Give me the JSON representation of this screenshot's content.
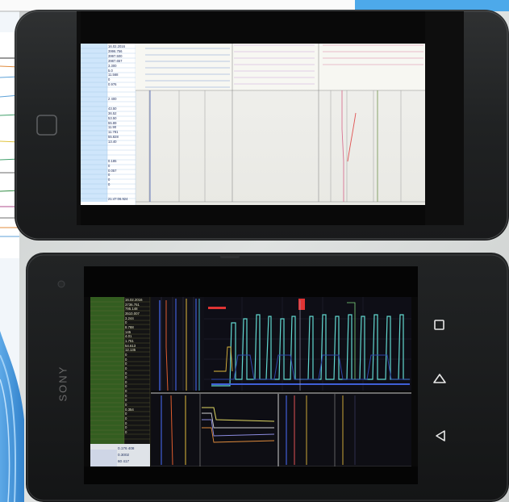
{
  "scene": {
    "description_items": [
      "upper-phone",
      "lower-phone",
      "sony-logo",
      "nav-buttons"
    ]
  },
  "lower_phone": {
    "brand": "SONY",
    "nav": {
      "back_icon": "back-triangle-icon",
      "home_icon": "home-icon",
      "recent_icon": "recent-apps-square-icon"
    },
    "sidebar_values": [
      "16.02.2016",
      "3736.751",
      "795.148",
      "3510.007",
      "3.244",
      "0",
      "8.788",
      "145",
      "4.01",
      "1.751",
      "54.613",
      "12.135",
      "0",
      "0",
      "0",
      "0",
      "0",
      "0",
      "0",
      "0",
      "0",
      "0",
      "0",
      "0",
      "0.354",
      "0",
      "0",
      "0",
      "0",
      "0"
    ],
    "bottom_values": [
      "0.176 408",
      "0.3002",
      "60 417"
    ]
  },
  "upper_phone": {
    "sidebar_values": [
      "16.02.2016",
      "3996.756",
      "3997.500",
      "3987.657",
      "3.300",
      "5.0",
      "11.568",
      "0",
      "0.976",
      "",
      "",
      "2 400",
      "",
      "43.50",
      "36.52",
      "53.50",
      "55.89",
      "11.90",
      "11.781",
      "55.828",
      "13.40",
      "",
      "",
      "",
      "0.185",
      "0",
      "0.057",
      "0",
      "0",
      "0",
      "",
      "",
      "21:47:06.924"
    ]
  }
}
